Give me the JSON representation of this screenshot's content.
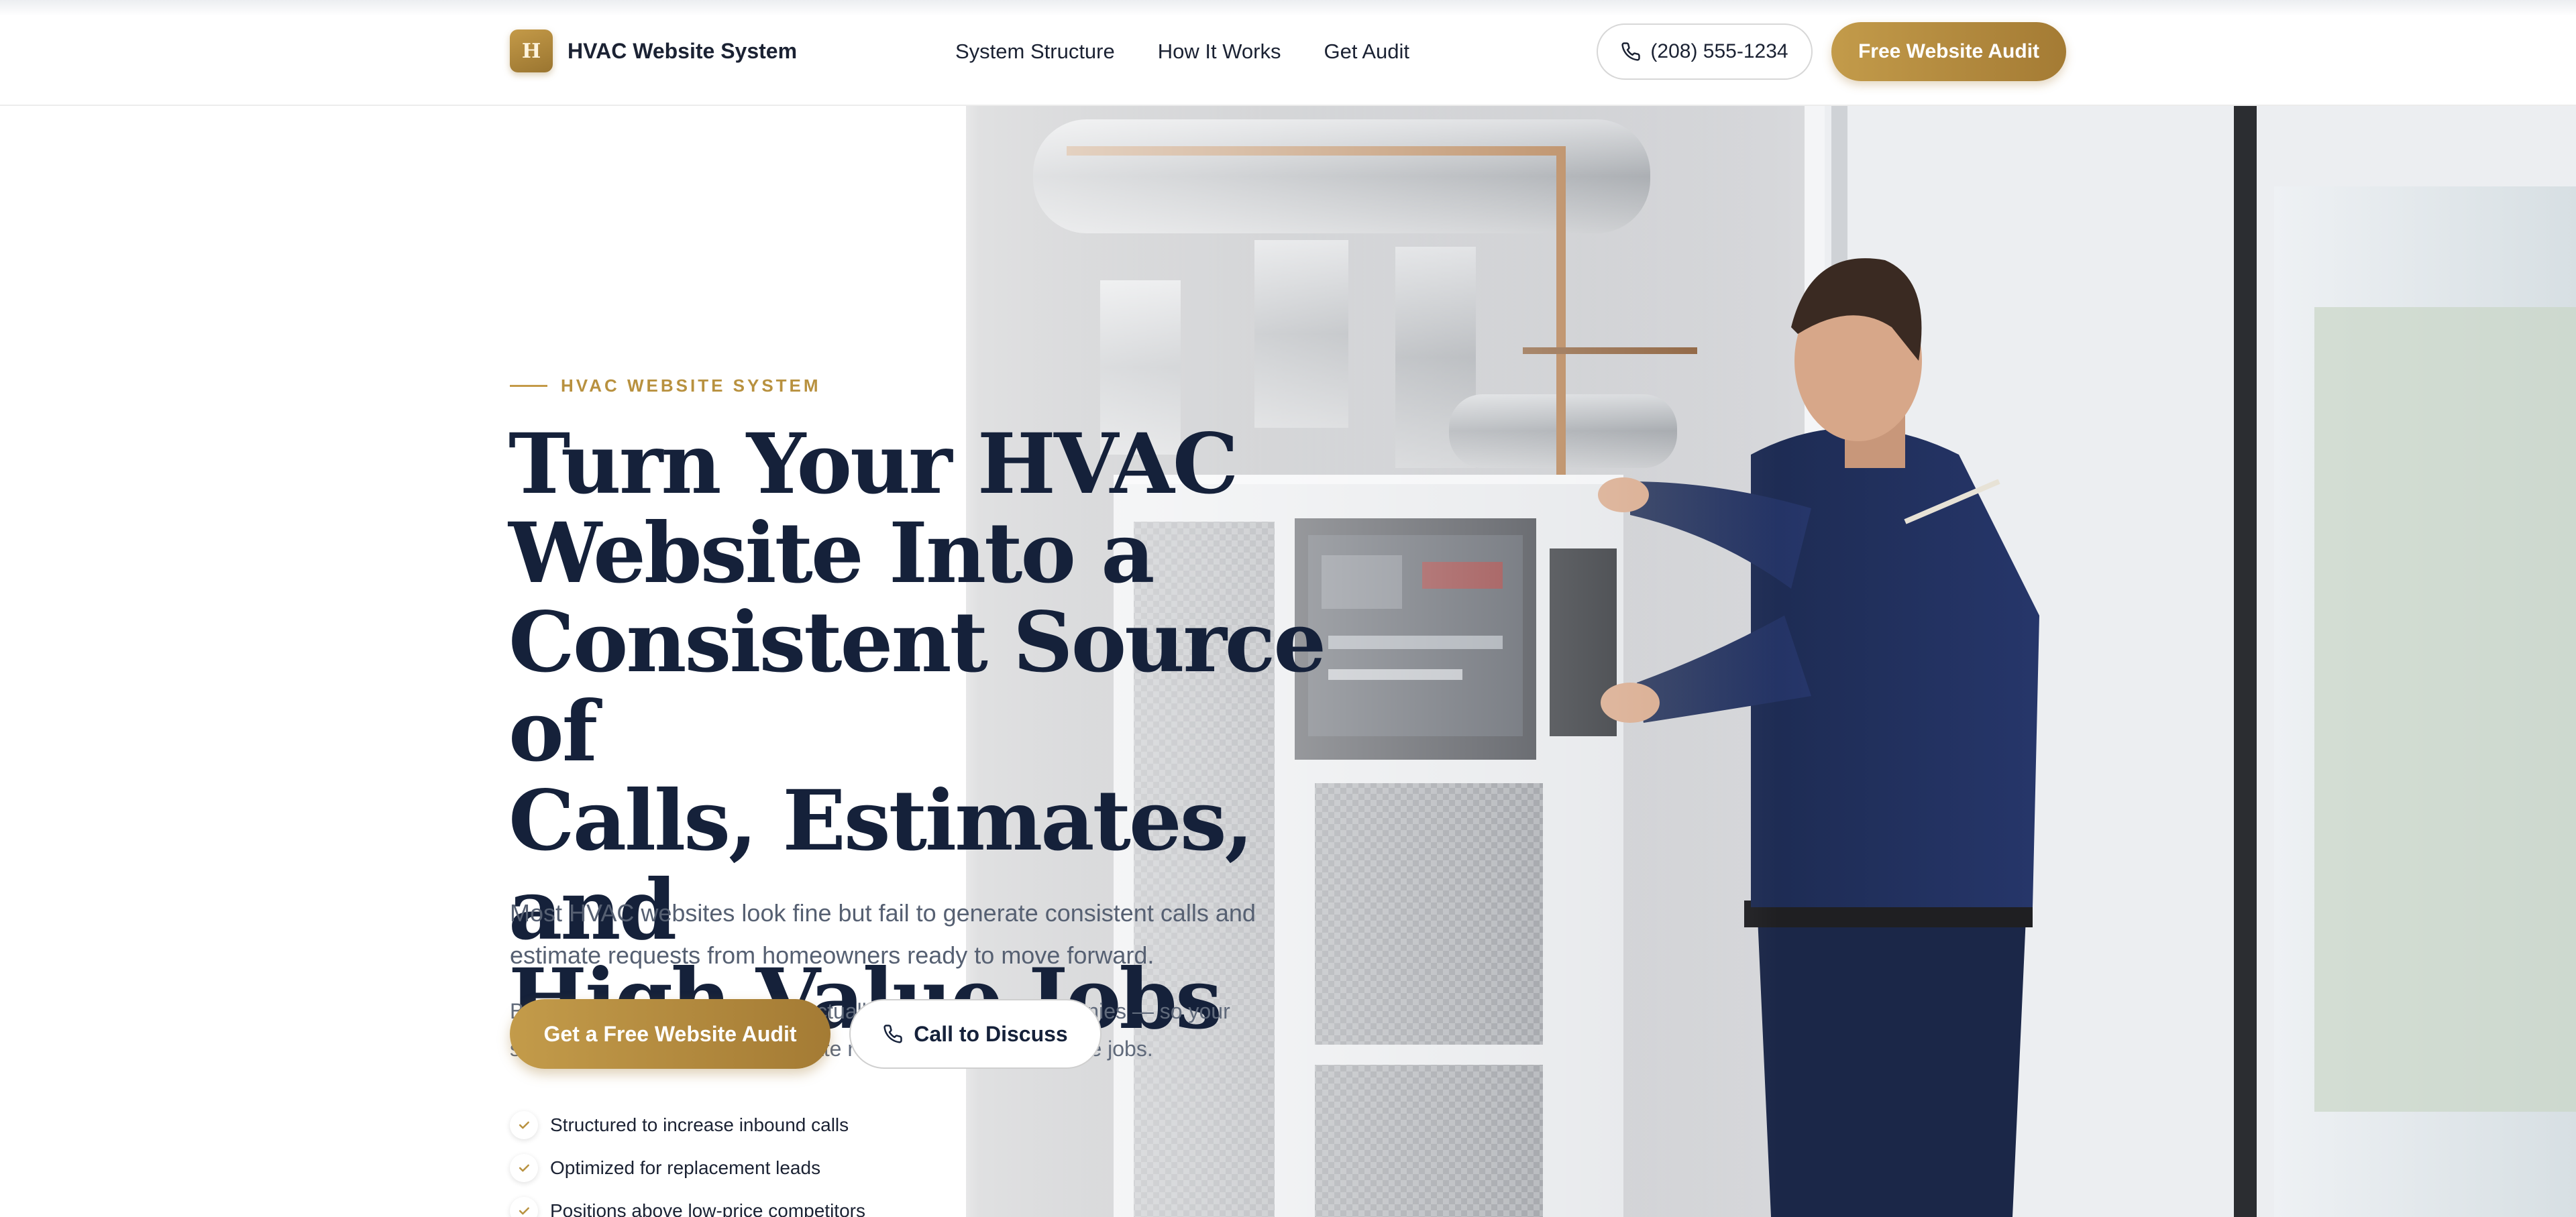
{
  "header": {
    "brand_initial": "H",
    "brand_name": "HVAC Website System",
    "nav": [
      {
        "label": "System Structure"
      },
      {
        "label": "How It Works"
      },
      {
        "label": "Get Audit"
      }
    ],
    "phone": "(208) 555-1234",
    "cta": "Free Website Audit"
  },
  "hero": {
    "eyebrow": "HVAC WEBSITE SYSTEM",
    "headline_lines": [
      "Turn Your HVAC",
      "Website Into a",
      "Consistent Source of",
      "Calls, Estimates, and",
      "High-Value Jobs"
    ],
    "lead": "Most HVAC websites look fine but fail to generate consistent calls and estimate requests from homeowners ready to move forward.",
    "sub": "Built around how homeowners actually choose HVAC companies — so your site generates more calls, estimate requests, and higher-value jobs.",
    "cta_primary": "Get a Free Website Audit",
    "cta_secondary": "Call to Discuss",
    "checks": [
      {
        "label": "Structured to increase inbound calls"
      },
      {
        "label": "Optimized for replacement leads"
      },
      {
        "label": "Positions above low-price competitors"
      }
    ]
  },
  "icons": {
    "phone": "phone-icon",
    "check": "check-icon"
  },
  "colors": {
    "accent": "#b8913f",
    "accent_dark": "#a47b34",
    "heading": "#15213a",
    "body_text": "#566072"
  }
}
